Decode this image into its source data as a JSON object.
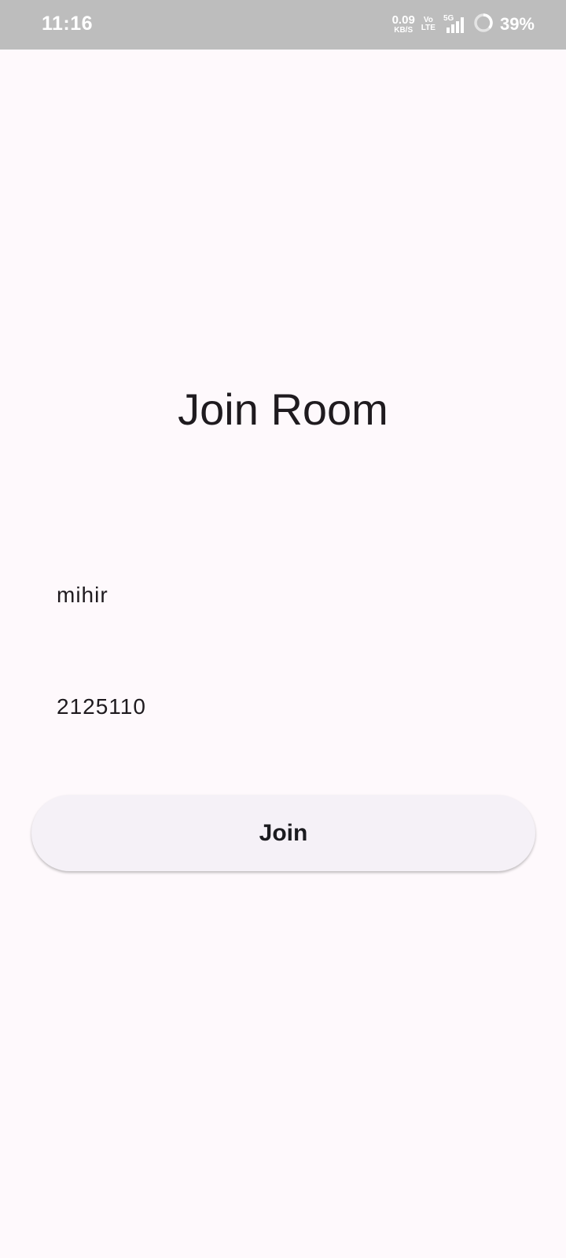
{
  "status_bar": {
    "time": "11:16",
    "net_speed_value": "0.09",
    "net_speed_unit": "KB/S",
    "volte_top": "Vo",
    "volte_bottom": "LTE",
    "network_type": "5G",
    "battery_percent": "39%",
    "icons": [
      "signal-icon",
      "battery-ring-icon"
    ]
  },
  "main": {
    "title": "Join Room"
  },
  "form": {
    "name_value": "mihir",
    "room_value": "2125110",
    "join_label": "Join"
  },
  "colors": {
    "background": "#fef9fc",
    "status_bar": "#bdbdbd",
    "button_bg": "#f5f1f7",
    "text": "#1f1b1f"
  }
}
